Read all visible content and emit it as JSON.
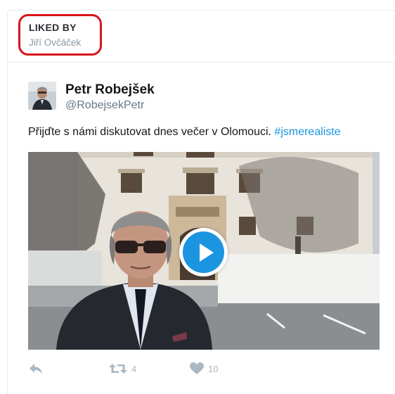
{
  "liked_by": {
    "title": "LIKED BY",
    "name": "Jiří Ovčáček"
  },
  "tweet": {
    "author_name": "Petr Robejšek",
    "author_handle": "@RobejsekPetr",
    "text": "Přijďte s námi diskutovat dnes večer v Olomouci.",
    "hashtag": "#jsmerealiste",
    "media": {
      "type": "video",
      "play_icon": "play-icon"
    },
    "actions": {
      "reply_icon": "reply-icon",
      "retweet_icon": "retweet-icon",
      "retweet_count": "4",
      "like_icon": "heart-icon",
      "like_count": "10"
    }
  },
  "colors": {
    "accent": "#1b95e0",
    "highlight_border": "#d9141c",
    "muted_text": "#8899a6",
    "action_icon": "#aab8c2"
  }
}
